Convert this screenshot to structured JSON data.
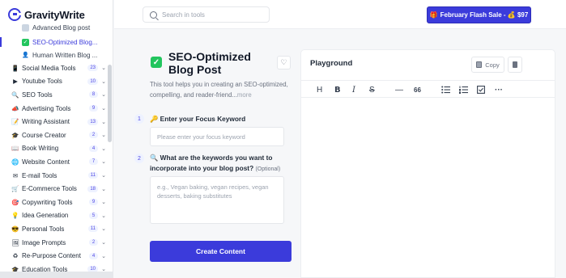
{
  "app": {
    "name": "GravityWrite"
  },
  "search": {
    "placeholder": "Search in tools"
  },
  "promo": {
    "label": "February Flash Sale - 💰 $97",
    "emoji": "🎁"
  },
  "sidebar": {
    "sub_items": [
      {
        "label": "Advanced Blog post",
        "icon": "document-icon",
        "active": false
      },
      {
        "label": "SEO-Optimized Blog...",
        "icon": "check-icon",
        "active": true
      },
      {
        "label": "Human Written Blog ...",
        "icon": "person-icon",
        "active": false
      }
    ],
    "items": [
      {
        "label": "Social Media Tools",
        "count": "23",
        "icon": "📱"
      },
      {
        "label": "Youtube Tools",
        "count": "10",
        "icon": "▶"
      },
      {
        "label": "SEO Tools",
        "count": "8",
        "icon": "🔍"
      },
      {
        "label": "Advertising Tools",
        "count": "9",
        "icon": "📣"
      },
      {
        "label": "Writing Assistant",
        "count": "13",
        "icon": "📝"
      },
      {
        "label": "Course Creator",
        "count": "2",
        "icon": "🎓"
      },
      {
        "label": "Book Writing",
        "count": "4",
        "icon": "📖"
      },
      {
        "label": "Website Content",
        "count": "7",
        "icon": "🌐"
      },
      {
        "label": "E-mail Tools",
        "count": "11",
        "icon": "✉"
      },
      {
        "label": "E-Commerce Tools",
        "count": "18",
        "icon": "🛒"
      },
      {
        "label": "Copywriting Tools",
        "count": "9",
        "icon": "🎯"
      },
      {
        "label": "Idea Generation",
        "count": "5",
        "icon": "💡"
      },
      {
        "label": "Personal Tools",
        "count": "11",
        "icon": "😎"
      },
      {
        "label": "Image Prompts",
        "count": "2",
        "icon": "🖼"
      },
      {
        "label": "Re-Purpose Content",
        "count": "4",
        "icon": "♻"
      },
      {
        "label": "Education Tools",
        "count": "10",
        "icon": "🎓"
      }
    ]
  },
  "tool": {
    "title": "SEO-Optimized Blog Post",
    "description": "This tool helps you in creating an SEO-optimized, compelling, and reader-friend...",
    "more_label": "more",
    "fields": [
      {
        "number": "1",
        "emoji": "🔑",
        "label": "Enter your Focus Keyword",
        "placeholder": "Please enter your focus keyword"
      },
      {
        "number": "2",
        "emoji": "🔍",
        "label": "What are the keywords you want to incorporate into your blog post?",
        "optional": "(Optional)",
        "placeholder": "e.g., Vegan baking, vegan recipes, vegan desserts, baking substitutes"
      }
    ],
    "submit_label": "Create Content"
  },
  "playground": {
    "title": "Playground",
    "copy_label": "Copy",
    "toolbar": [
      "H",
      "B",
      "I",
      "S",
      "—",
      "66",
      "bullet-list",
      "numbered-list",
      "checklist",
      "···"
    ]
  },
  "colors": {
    "accent": "#3b3bdb",
    "success": "#22c55e",
    "badge_bg": "#eef2ff"
  }
}
